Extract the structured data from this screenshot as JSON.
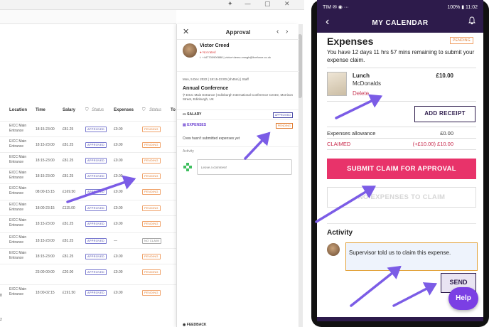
{
  "window": {
    "min": "—",
    "max": "▢",
    "close": "✕"
  },
  "table": {
    "headers": [
      "Location",
      "Time",
      "Salary",
      "Status",
      "Expenses",
      "Status",
      "To"
    ],
    "rows": [
      {
        "loc1": "EICC Main",
        "loc2": "Entrance",
        "time": "18:15-23:00",
        "salary": "£81.25",
        "status": "APPROVED",
        "expenses": "£0.00",
        "exp_status": "PENDING"
      },
      {
        "loc1": "EICC Main",
        "loc2": "Entrance",
        "time": "18:15-23:00",
        "salary": "£81.25",
        "status": "APPROVED",
        "expenses": "£0.00",
        "exp_status": "PENDING"
      },
      {
        "loc1": "EICC Main",
        "loc2": "Entrance",
        "time": "18:15-23:00",
        "salary": "£81.25",
        "status": "APPROVED",
        "expenses": "£0.00",
        "exp_status": "PENDING"
      },
      {
        "loc1": "EICC Main",
        "loc2": "Entrance",
        "time": "18:15-23:00",
        "salary": "£81.25",
        "status": "APPROVED",
        "expenses": "£0.00",
        "exp_status": "PENDING"
      },
      {
        "loc1": "EICC Main",
        "loc2": "Entrance",
        "time": "08:00-15:15",
        "salary": "£169.50",
        "status": "APPROVED",
        "expenses": "£0.00",
        "exp_status": "PENDING"
      },
      {
        "loc1": "EICC Main",
        "loc2": "Entrance",
        "time": "18:00-23:15",
        "salary": "£115.00",
        "status": "APPROVED",
        "expenses": "£0.00",
        "exp_status": "PENDING"
      },
      {
        "loc1": "EICC Main",
        "loc2": "Entrance",
        "time": "18:15-23:00",
        "salary": "£81.25",
        "status": "APPROVED",
        "expenses": "£0.00",
        "exp_status": "PENDING"
      },
      {
        "loc1": "EICC Main",
        "loc2": "Entrance",
        "time": "18:15-23:00",
        "salary": "£81.25",
        "status": "APPROVED",
        "expenses": "—",
        "exp_status": "NO CLAIM"
      },
      {
        "loc1": "EICC Main",
        "loc2": "Entrance",
        "time": "18:15-23:00",
        "salary": "£81.25",
        "status": "APPROVED",
        "expenses": "£0.00",
        "exp_status": "PENDING"
      },
      {
        "loc1": "",
        "loc2": "",
        "time": "23:00-00:00",
        "salary": "£20.00",
        "status": "APPROVED",
        "expenses": "£0.00",
        "exp_status": "PENDING"
      },
      {
        "loc1": "EICC Main",
        "loc2": "Entrance",
        "time": "18:00-02:15",
        "salary": "£191.50",
        "status": "APPROVED",
        "expenses": "£0.00",
        "exp_status": "PENDING"
      }
    ],
    "edge_numbers": [
      "8",
      "2"
    ]
  },
  "approval": {
    "title": "Approval",
    "close": "✕",
    "prev": "‹",
    "next": "›",
    "name": "Victor Creed",
    "rated": "● Not rated",
    "contact": "t. +447700900888 | victor+demo.vmsgb@liveforce.co.uk",
    "date": "Mon, 5 Dec 2022 | 18:15-23:00 (4h45m) | Staff",
    "event": "Annual Conference",
    "address": "EICC Main Entrance | Edinburgh International Conference Centre, Morrison Street, Edinburgh, UK",
    "salary_label": "SALARY",
    "salary_status": "APPROVED",
    "expenses_label": "EXPENSES",
    "expenses_status": "PENDING",
    "note": "Crew hasn't submitted expenses yet",
    "activity": "Activity",
    "comment_placeholder": "Leave a comment",
    "feedback": "FEEDBACK"
  },
  "mobile": {
    "status_left": "TIM ✉ ◉ ···",
    "status_right": "100% ▮ 11:02",
    "app_title": "MY CALENDAR",
    "back": "‹",
    "bell": "🔔",
    "title": "Expenses",
    "pending": "PENDING",
    "remaining": "You have 12 days 11 hrs 57 mins remaining to submit your expense claim.",
    "item": "Lunch",
    "vendor": "McDonalds",
    "delete": "Delete",
    "price": "£10.00",
    "add_receipt": "ADD RECEIPT",
    "allowance_label": "Expenses allowance",
    "allowance_value": "£0.00",
    "claimed_label": "CLAIMED",
    "claimed_value": "(+£10.00) £10.00",
    "submit": "SUBMIT CLAIM FOR APPROVAL",
    "no_expenses": "NO EXPENSES TO CLAIM",
    "activity": "Activity",
    "comment": "Supervisor told us to claim this expense.",
    "send": "SEND",
    "help": "Help"
  },
  "colors": {
    "brand": "#2d1b4b",
    "accent": "#e8336a",
    "annotation_arrow": "#7b5ce6",
    "pending": "#e07a2e",
    "approved": "#4a4aa8"
  }
}
